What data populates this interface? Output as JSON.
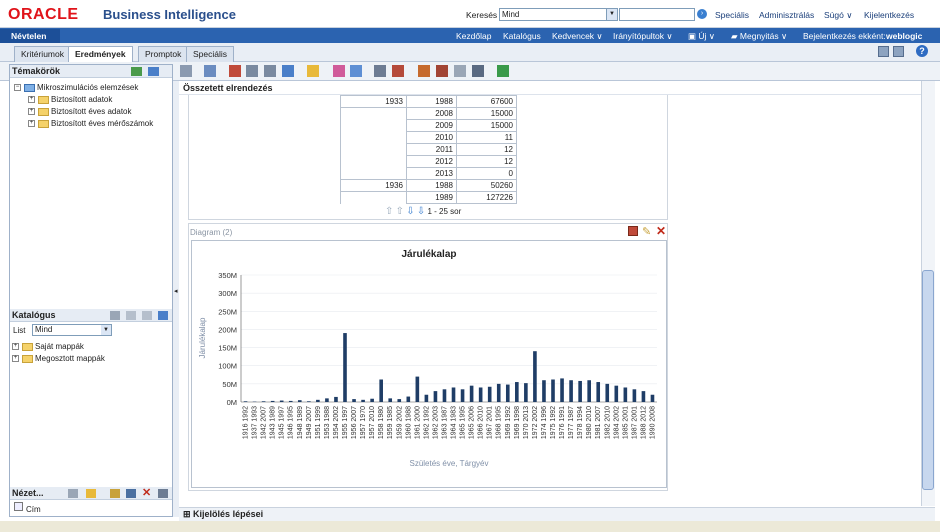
{
  "header": {
    "logo": "ORACLE",
    "product": "Business Intelligence",
    "search_label": "Keresés",
    "search_scope": "Mind",
    "links": [
      "Speciális",
      "Adminisztrálás",
      "Súgó ∨",
      "Kijelentkezés"
    ]
  },
  "navbar": {
    "doc_title": "Névtelen",
    "links": [
      "Kezdőlap",
      "Katalógus",
      "Kedvencek ∨",
      "Irányítópultok ∨",
      "Új ∨",
      "Megnyitás ∨",
      "Bejelentkezés ekként:"
    ],
    "user": "weblogic"
  },
  "tabs": [
    "Kritériumok",
    "Eredmények",
    "Promptok",
    "Speciális"
  ],
  "subjects": {
    "title": "Témakörök",
    "root": "Mikroszimulációs elemzések",
    "folders": [
      "Biztosított adatok",
      "Biztosított éves adatok",
      "Biztosított éves mérőszámok"
    ]
  },
  "catalog": {
    "title": "Katalógus",
    "list_label": "List",
    "list_value": "Mind",
    "folders": [
      "Saját mappák",
      "Megosztott mappák"
    ]
  },
  "views": {
    "title": "Nézet...",
    "item": "Cím"
  },
  "layout": {
    "title": "Összetett elrendezés"
  },
  "pivot": {
    "rows": [
      [
        "1933",
        "1988",
        "67600"
      ],
      [
        "",
        "2008",
        "15000"
      ],
      [
        "",
        "2009",
        "15000"
      ],
      [
        "",
        "2010",
        "11"
      ],
      [
        "",
        "2011",
        "12"
      ],
      [
        "",
        "2012",
        "12"
      ],
      [
        "",
        "2013",
        "0"
      ],
      [
        "1936",
        "1988",
        "50260"
      ],
      [
        "",
        "1989",
        "127226"
      ]
    ],
    "pager": "1 - 25 sor"
  },
  "chart_caption": "Diagram (2)",
  "selection_steps": "Kijelölés lépései",
  "chart_data": {
    "type": "bar",
    "title": "Járulékalap",
    "xlabel": "Születés éve, Tárgyév",
    "ylabel": "Járulékalap",
    "ylim": [
      0,
      350
    ],
    "y_ticks": [
      "0M",
      "50M",
      "100M",
      "150M",
      "200M",
      "250M",
      "300M",
      "350M"
    ],
    "categories": [
      "1916 1992",
      "1937 1993",
      "1942 2007",
      "1943 1989",
      "1945 1997",
      "1946 1995",
      "1948 1989",
      "1949 2007",
      "1951 1999",
      "1953 1988",
      "1954 2002",
      "1955 1997",
      "1956 2007",
      "1957 1970",
      "1957 2010",
      "1958 1980",
      "1959 1985",
      "1959 2002",
      "1960 1988",
      "1961 2000",
      "1962 1992",
      "1962 2003",
      "1963 1987",
      "1964 1983",
      "1965 1995",
      "1965 2006",
      "1966 2010",
      "1967 2001",
      "1968 1995",
      "1969 1992",
      "1969 1998",
      "1970 2013",
      "1972 2002",
      "1974 1996",
      "1975 1992",
      "1976 1991",
      "1977 1987",
      "1978 1994",
      "1980 2010",
      "1981 2007",
      "1982 2010",
      "1984 2002",
      "1985 2001",
      "1987 2001",
      "1988 2012",
      "1990 2008"
    ],
    "values": [
      2,
      1,
      2,
      3,
      4,
      3,
      5,
      2,
      6,
      10,
      14,
      190,
      8,
      6,
      9,
      62,
      10,
      8,
      15,
      70,
      20,
      30,
      35,
      40,
      35,
      45,
      40,
      42,
      50,
      48,
      55,
      52,
      140,
      60,
      62,
      65,
      60,
      58,
      60,
      55,
      50,
      45,
      40,
      35,
      30,
      20
    ]
  }
}
